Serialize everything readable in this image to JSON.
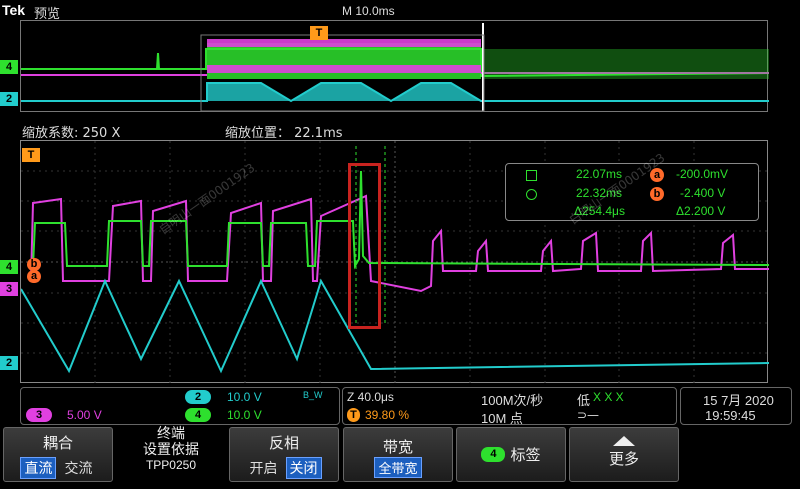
{
  "header": {
    "brand": "Tek",
    "mode": "预览",
    "main_timebase": "M 10.0ms"
  },
  "zoom": {
    "factor_label": "缩放系数: 250 X",
    "position_label": "缩放位置： 22.1ms"
  },
  "trigger_marker": "T",
  "channels": [
    {
      "id": "4",
      "color": "#2ee02e"
    },
    {
      "id": "2",
      "color": "#22cccc"
    },
    {
      "id": "3",
      "color": "#e040e0"
    }
  ],
  "cursor_readout": {
    "cursor1_time": "22.07ms",
    "cursor2_time": "22.32ms",
    "delta_time": "Δ254.4μs",
    "a_value": "-200.0mV",
    "b_value": "-2.400 V",
    "delta_value": "Δ2.200 V",
    "a_label": "a",
    "b_label": "b"
  },
  "vertical": {
    "ch2_scale": "10.0 V",
    "ch2_bw": "B_W",
    "ch3_scale": "5.00 V",
    "ch4_scale": "10.0 V"
  },
  "horizontal": {
    "zoom_scale": "Z 40.0μs",
    "trigger_pos": "39.80 %",
    "sample_rate": "100M次/秒",
    "record_length": "10M 点",
    "trigger_level_label": "低",
    "trigger_x": "X  X  X"
  },
  "datetime": {
    "date": "15 7月 2020",
    "time": "19:59:45"
  },
  "softkeys": {
    "coupling_title": "耦合",
    "coupling_dc": "直流",
    "coupling_ac": "交流",
    "term_line1": "终端",
    "term_line2": "设置依据",
    "term_line3": "TPP0250",
    "invert_title": "反相",
    "invert_on": "开启",
    "invert_off": "关闭",
    "bw_title": "带宽",
    "bw_value": "全带宽",
    "label_badge": "4",
    "label_title": "标签",
    "more_title": "更多"
  },
  "watermarks": [
    "自明山一面0001923",
    "白明山一面0001923"
  ]
}
